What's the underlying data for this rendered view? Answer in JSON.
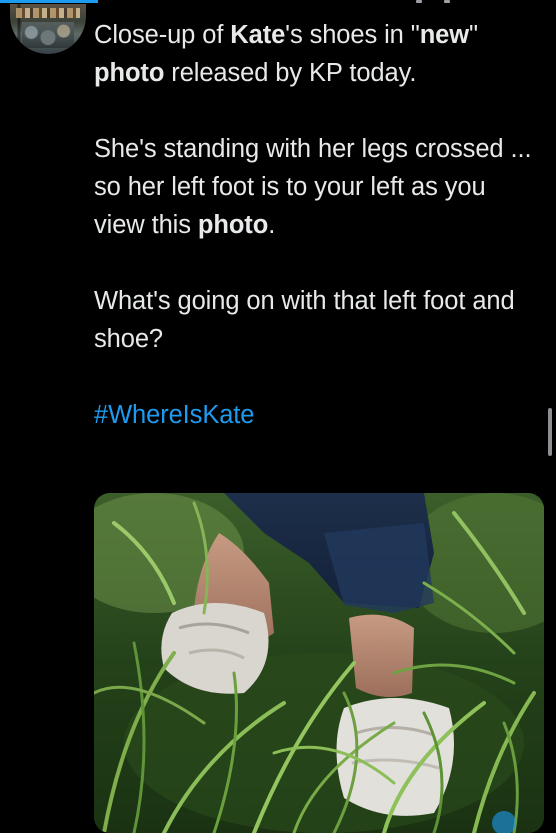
{
  "tweet": {
    "line1_pre": "Close-up of ",
    "line1_bold1": "Kate",
    "line1_mid": "'s shoes in \"",
    "line1_bold2": "new",
    "line1_mid2": "\" ",
    "line1_bold3": "photo",
    "line1_post": " released by KP today.",
    "para2_pre": "She's standing with her legs crossed ... so her left foot is to your left as you view this ",
    "para2_bold": "photo",
    "para2_post": ".",
    "para3": "What's going on with that left foot and shoe?",
    "hashtag": "#WhereIsKate"
  },
  "colors": {
    "background": "#000000",
    "text": "#e7e9ea",
    "link": "#1d9bf0"
  },
  "icons": {
    "avatar": "user-avatar-photo"
  }
}
